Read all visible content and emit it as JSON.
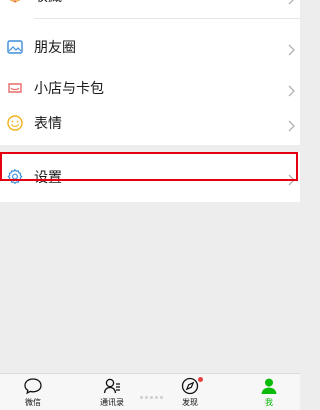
{
  "menu": {
    "items": [
      {
        "label": "收藏",
        "icon": "cube-favorites-icon"
      },
      {
        "label": "朋友圈",
        "icon": "moments-picture-icon"
      },
      {
        "label": "小店与卡包",
        "icon": "shop-cards-icon"
      },
      {
        "label": "表情",
        "icon": "smiley-emoji-icon"
      },
      {
        "label": "设置",
        "icon": "gear-settings-icon"
      }
    ]
  },
  "tabbar": {
    "tabs": [
      {
        "label": "微信",
        "icon": "chat-bubble-icon",
        "active": false
      },
      {
        "label": "通讯录",
        "icon": "contacts-icon",
        "active": false
      },
      {
        "label": "发现",
        "icon": "compass-discover-icon",
        "active": false,
        "badge": true
      },
      {
        "label": "我",
        "icon": "person-me-icon",
        "active": true
      }
    ]
  },
  "colors": {
    "highlight_border": "#e60012",
    "active_tab": "#09bb07",
    "badge": "#e64340"
  }
}
